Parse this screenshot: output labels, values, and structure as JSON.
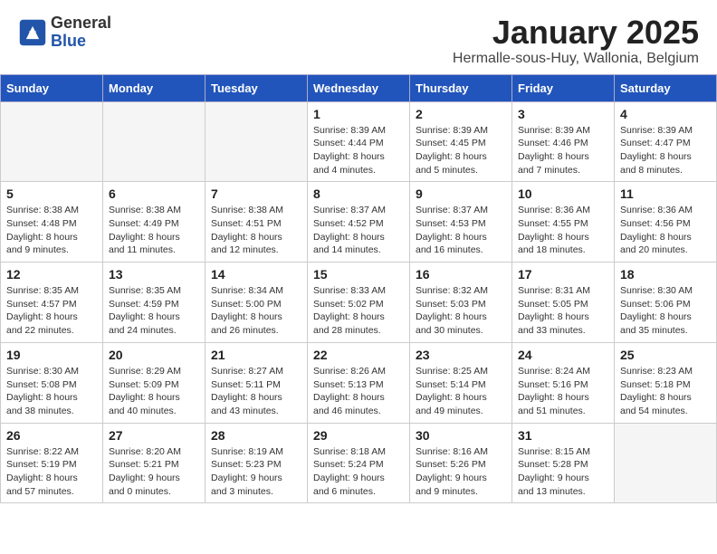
{
  "header": {
    "logo_general": "General",
    "logo_blue": "Blue",
    "title": "January 2025",
    "subtitle": "Hermalle-sous-Huy, Wallonia, Belgium"
  },
  "weekdays": [
    "Sunday",
    "Monday",
    "Tuesday",
    "Wednesday",
    "Thursday",
    "Friday",
    "Saturday"
  ],
  "weeks": [
    [
      {
        "day": "",
        "info": ""
      },
      {
        "day": "",
        "info": ""
      },
      {
        "day": "",
        "info": ""
      },
      {
        "day": "1",
        "info": "Sunrise: 8:39 AM\nSunset: 4:44 PM\nDaylight: 8 hours\nand 4 minutes."
      },
      {
        "day": "2",
        "info": "Sunrise: 8:39 AM\nSunset: 4:45 PM\nDaylight: 8 hours\nand 5 minutes."
      },
      {
        "day": "3",
        "info": "Sunrise: 8:39 AM\nSunset: 4:46 PM\nDaylight: 8 hours\nand 7 minutes."
      },
      {
        "day": "4",
        "info": "Sunrise: 8:39 AM\nSunset: 4:47 PM\nDaylight: 8 hours\nand 8 minutes."
      }
    ],
    [
      {
        "day": "5",
        "info": "Sunrise: 8:38 AM\nSunset: 4:48 PM\nDaylight: 8 hours\nand 9 minutes."
      },
      {
        "day": "6",
        "info": "Sunrise: 8:38 AM\nSunset: 4:49 PM\nDaylight: 8 hours\nand 11 minutes."
      },
      {
        "day": "7",
        "info": "Sunrise: 8:38 AM\nSunset: 4:51 PM\nDaylight: 8 hours\nand 12 minutes."
      },
      {
        "day": "8",
        "info": "Sunrise: 8:37 AM\nSunset: 4:52 PM\nDaylight: 8 hours\nand 14 minutes."
      },
      {
        "day": "9",
        "info": "Sunrise: 8:37 AM\nSunset: 4:53 PM\nDaylight: 8 hours\nand 16 minutes."
      },
      {
        "day": "10",
        "info": "Sunrise: 8:36 AM\nSunset: 4:55 PM\nDaylight: 8 hours\nand 18 minutes."
      },
      {
        "day": "11",
        "info": "Sunrise: 8:36 AM\nSunset: 4:56 PM\nDaylight: 8 hours\nand 20 minutes."
      }
    ],
    [
      {
        "day": "12",
        "info": "Sunrise: 8:35 AM\nSunset: 4:57 PM\nDaylight: 8 hours\nand 22 minutes."
      },
      {
        "day": "13",
        "info": "Sunrise: 8:35 AM\nSunset: 4:59 PM\nDaylight: 8 hours\nand 24 minutes."
      },
      {
        "day": "14",
        "info": "Sunrise: 8:34 AM\nSunset: 5:00 PM\nDaylight: 8 hours\nand 26 minutes."
      },
      {
        "day": "15",
        "info": "Sunrise: 8:33 AM\nSunset: 5:02 PM\nDaylight: 8 hours\nand 28 minutes."
      },
      {
        "day": "16",
        "info": "Sunrise: 8:32 AM\nSunset: 5:03 PM\nDaylight: 8 hours\nand 30 minutes."
      },
      {
        "day": "17",
        "info": "Sunrise: 8:31 AM\nSunset: 5:05 PM\nDaylight: 8 hours\nand 33 minutes."
      },
      {
        "day": "18",
        "info": "Sunrise: 8:30 AM\nSunset: 5:06 PM\nDaylight: 8 hours\nand 35 minutes."
      }
    ],
    [
      {
        "day": "19",
        "info": "Sunrise: 8:30 AM\nSunset: 5:08 PM\nDaylight: 8 hours\nand 38 minutes."
      },
      {
        "day": "20",
        "info": "Sunrise: 8:29 AM\nSunset: 5:09 PM\nDaylight: 8 hours\nand 40 minutes."
      },
      {
        "day": "21",
        "info": "Sunrise: 8:27 AM\nSunset: 5:11 PM\nDaylight: 8 hours\nand 43 minutes."
      },
      {
        "day": "22",
        "info": "Sunrise: 8:26 AM\nSunset: 5:13 PM\nDaylight: 8 hours\nand 46 minutes."
      },
      {
        "day": "23",
        "info": "Sunrise: 8:25 AM\nSunset: 5:14 PM\nDaylight: 8 hours\nand 49 minutes."
      },
      {
        "day": "24",
        "info": "Sunrise: 8:24 AM\nSunset: 5:16 PM\nDaylight: 8 hours\nand 51 minutes."
      },
      {
        "day": "25",
        "info": "Sunrise: 8:23 AM\nSunset: 5:18 PM\nDaylight: 8 hours\nand 54 minutes."
      }
    ],
    [
      {
        "day": "26",
        "info": "Sunrise: 8:22 AM\nSunset: 5:19 PM\nDaylight: 8 hours\nand 57 minutes."
      },
      {
        "day": "27",
        "info": "Sunrise: 8:20 AM\nSunset: 5:21 PM\nDaylight: 9 hours\nand 0 minutes."
      },
      {
        "day": "28",
        "info": "Sunrise: 8:19 AM\nSunset: 5:23 PM\nDaylight: 9 hours\nand 3 minutes."
      },
      {
        "day": "29",
        "info": "Sunrise: 8:18 AM\nSunset: 5:24 PM\nDaylight: 9 hours\nand 6 minutes."
      },
      {
        "day": "30",
        "info": "Sunrise: 8:16 AM\nSunset: 5:26 PM\nDaylight: 9 hours\nand 9 minutes."
      },
      {
        "day": "31",
        "info": "Sunrise: 8:15 AM\nSunset: 5:28 PM\nDaylight: 9 hours\nand 13 minutes."
      },
      {
        "day": "",
        "info": ""
      }
    ]
  ]
}
